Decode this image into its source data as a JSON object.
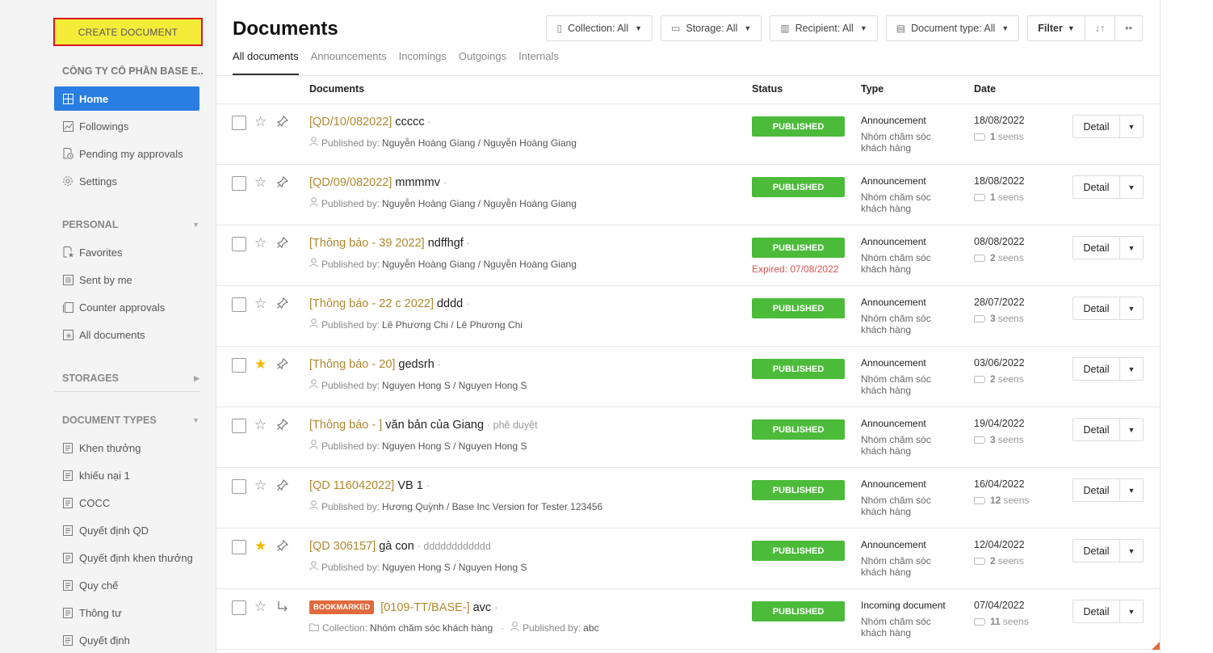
{
  "sidebar": {
    "create_label": "CREATE DOCUMENT",
    "company": "CÔNG TY CỔ PHẦN BASE E...",
    "main_nav": [
      {
        "label": "Home",
        "icon": "grid-icon"
      },
      {
        "label": "Followings",
        "icon": "chart-icon"
      },
      {
        "label": "Pending my approvals",
        "icon": "doc-clock-icon"
      },
      {
        "label": "Settings",
        "icon": "gear-icon"
      }
    ],
    "personal_header": "PERSONAL",
    "personal": [
      {
        "label": "Favorites",
        "icon": "doc-star-icon"
      },
      {
        "label": "Sent by me",
        "icon": "list-icon"
      },
      {
        "label": "Counter approvals",
        "icon": "copy-icon"
      },
      {
        "label": "All documents",
        "icon": "asterisk-icon"
      }
    ],
    "storages_header": "STORAGES",
    "doctypes_header": "DOCUMENT TYPES",
    "doctypes": [
      {
        "label": "Khen thưởng"
      },
      {
        "label": "khiếu nại 1"
      },
      {
        "label": "COCC"
      },
      {
        "label": "Quyết định QD"
      },
      {
        "label": "Quyết định khen thưởng"
      },
      {
        "label": "Quy chế"
      },
      {
        "label": "Thông tư"
      },
      {
        "label": "Quyết định"
      }
    ]
  },
  "header": {
    "title": "Documents",
    "filters": {
      "collection": "Collection: All",
      "storage": "Storage: All",
      "recipient": "Recipient: All",
      "doctype": "Document type: All",
      "filter": "Filter",
      "sort": "↓↑",
      "more": "••"
    },
    "tabs": [
      "All documents",
      "Announcements",
      "Incomings",
      "Outgoings",
      "Internals"
    ]
  },
  "table": {
    "columns": {
      "documents": "Documents",
      "status": "Status",
      "type": "Type",
      "date": "Date"
    },
    "rows": [
      {
        "code": "[QD/10/082022]",
        "name": "ccccc",
        "extra": "·",
        "pub_label": "Published by:",
        "pub_by": "Nguyễn Hoàng Giang / Nguyễn Hoàng Giang",
        "status": "PUBLISHED",
        "expired": "",
        "type": "Announcement",
        "type_sub": "Nhóm chăm sóc khách hàng",
        "date": "18/08/2022",
        "seen_count": "1",
        "seen_label": "seens",
        "detail": "Detail",
        "starred": false,
        "bookmark": ""
      },
      {
        "code": "[QD/09/082022]",
        "name": "mmmmv",
        "extra": "·",
        "pub_label": "Published by:",
        "pub_by": "Nguyễn Hoàng Giang / Nguyễn Hoàng Giang",
        "status": "PUBLISHED",
        "expired": "",
        "type": "Announcement",
        "type_sub": "Nhóm chăm sóc khách hàng",
        "date": "18/08/2022",
        "seen_count": "1",
        "seen_label": "seens",
        "detail": "Detail",
        "starred": false,
        "bookmark": ""
      },
      {
        "code": "[Thông báo - 39 2022]",
        "name": "ndffhgf",
        "extra": "·",
        "pub_label": "Published by:",
        "pub_by": "Nguyễn Hoàng Giang / Nguyễn Hoàng Giang",
        "status": "PUBLISHED",
        "expired": "Expired: 07/08/2022",
        "type": "Announcement",
        "type_sub": "Nhóm chăm sóc khách hàng",
        "date": "08/08/2022",
        "seen_count": "2",
        "seen_label": "seens",
        "detail": "Detail",
        "starred": false,
        "bookmark": ""
      },
      {
        "code": "[Thông báo - 22 c 2022]",
        "name": "dddd",
        "extra": "·",
        "pub_label": "Published by:",
        "pub_by": "Lê Phương Chi / Lê Phương Chi",
        "status": "PUBLISHED",
        "expired": "",
        "type": "Announcement",
        "type_sub": "Nhóm chăm sóc khách hàng",
        "date": "28/07/2022",
        "seen_count": "3",
        "seen_label": "seens",
        "detail": "Detail",
        "starred": false,
        "bookmark": ""
      },
      {
        "code": "[Thông báo - 20]",
        "name": "gedsrh",
        "extra": "·",
        "pub_label": "Published by:",
        "pub_by": "Nguyen Hong S / Nguyen Hong S",
        "status": "PUBLISHED",
        "expired": "",
        "type": "Announcement",
        "type_sub": "Nhóm chăm sóc khách hàng",
        "date": "03/06/2022",
        "seen_count": "2",
        "seen_label": "seens",
        "detail": "Detail",
        "starred": true,
        "bookmark": ""
      },
      {
        "code": "[Thông báo - ]",
        "name": "văn bản của Giang",
        "extra": "· phê duyệt",
        "pub_label": "Published by:",
        "pub_by": "Nguyen Hong S / Nguyen Hong S",
        "status": "PUBLISHED",
        "expired": "",
        "type": "Announcement",
        "type_sub": "Nhóm chăm sóc khách hàng",
        "date": "19/04/2022",
        "seen_count": "3",
        "seen_label": "seens",
        "detail": "Detail",
        "starred": false,
        "bookmark": ""
      },
      {
        "code": "[QD 116042022]",
        "name": "VB 1",
        "extra": "·",
        "pub_label": "Published by:",
        "pub_by": "Hương Quỳnh / Base Inc Version for Tester 123456",
        "status": "PUBLISHED",
        "expired": "",
        "type": "Announcement",
        "type_sub": "Nhóm chăm sóc khách hàng",
        "date": "16/04/2022",
        "seen_count": "12",
        "seen_label": "seens",
        "detail": "Detail",
        "starred": false,
        "bookmark": ""
      },
      {
        "code": "[QD 306157]",
        "name": "gà con",
        "extra": "· dddddddddddd",
        "pub_label": "Published by:",
        "pub_by": "Nguyen Hong S / Nguyen Hong S",
        "status": "PUBLISHED",
        "expired": "",
        "type": "Announcement",
        "type_sub": "Nhóm chăm sóc khách hàng",
        "date": "12/04/2022",
        "seen_count": "2",
        "seen_label": "seens",
        "detail": "Detail",
        "starred": true,
        "bookmark": ""
      },
      {
        "code": "[0109-TT/BASE-]",
        "name": "avc",
        "extra": "·",
        "pub_label": "Collection:",
        "pub_by": "Nhóm chăm sóc khách hàng",
        "pub2_label": "Published by:",
        "pub2_by": "abc",
        "status": "PUBLISHED",
        "expired": "",
        "type": "Incoming document",
        "type_sub": "Nhóm chăm sóc khách hàng",
        "date": "07/04/2022",
        "seen_count": "11",
        "seen_label": "seens",
        "detail": "Detail",
        "starred": false,
        "bookmark": "BOOKMARKED"
      }
    ]
  },
  "colors": {
    "primary": "#2a7de1",
    "published": "#4cbb3a",
    "code": "#b0882d",
    "create_bg": "#f5ec3a",
    "create_border": "#d9161d",
    "bookmark": "#e06a3e",
    "expired": "#d9534f",
    "star_on": "#f5b800"
  }
}
